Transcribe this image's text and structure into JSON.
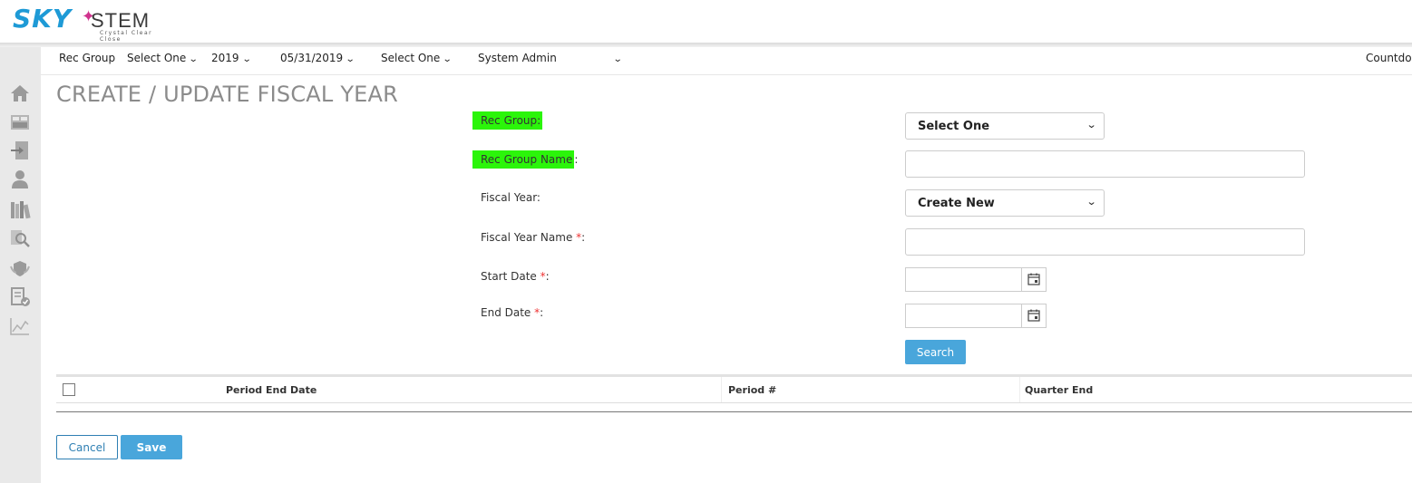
{
  "logo": {
    "brand_left": "SKY",
    "brand_right": "STEM",
    "tagline": "Crystal Clear Close"
  },
  "filterbar": {
    "rec_group_label": "Rec Group",
    "rec_group_value": "Select One",
    "year_value": "2019",
    "date_value": "05/31/2019",
    "entity_value": "Select One",
    "user_value": "System Admin",
    "countdown_label": "Countdo"
  },
  "sidebar": {
    "icons": [
      "home-icon",
      "dashboard-icon",
      "import-icon",
      "user-icon",
      "library-icon",
      "search-report-icon",
      "shield-icon",
      "document-check-icon",
      "chart-line-icon"
    ]
  },
  "page": {
    "title": "CREATE / UPDATE FISCAL YEAR"
  },
  "form": {
    "rec_group_label": "Rec Group:",
    "rec_group_select": "Select One",
    "rec_group_name_label": "Rec Group Name",
    "rec_group_name_colon": ":",
    "rec_group_name_value": "",
    "fiscal_year_label": "Fiscal Year:",
    "fiscal_year_select": "Create New",
    "fiscal_year_name_label": "Fiscal Year Name ",
    "fiscal_year_name_value": "",
    "start_date_label": "Start Date ",
    "start_date_value": "",
    "end_date_label": "End Date ",
    "end_date_value": "",
    "required_mark": "*",
    "colon": ":",
    "search_label": "Search"
  },
  "table": {
    "columns": [
      "Period End Date",
      "Period #",
      "Quarter End"
    ],
    "rows": []
  },
  "footer": {
    "cancel_label": "Cancel",
    "save_label": "Save"
  },
  "colors": {
    "accent": "#49a6db",
    "highlight": "#2bf50a",
    "sidebar_bg": "#e9e9e9",
    "title": "#8b8b8b",
    "required": "#e33333"
  }
}
